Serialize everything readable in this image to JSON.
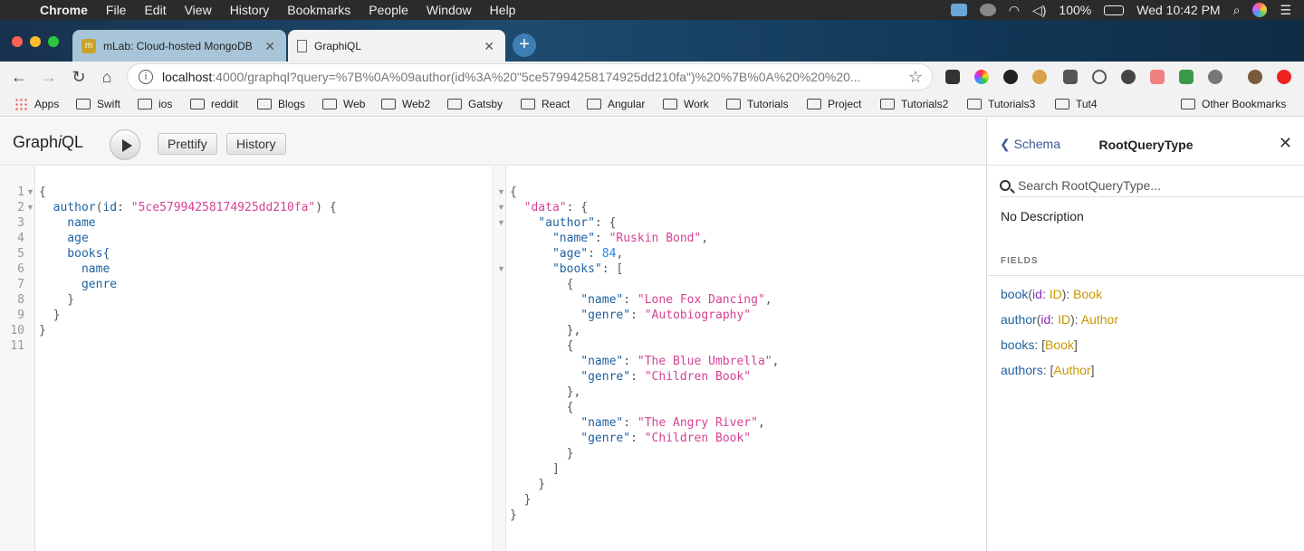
{
  "menubar": {
    "app_name": "Chrome",
    "items": [
      "File",
      "Edit",
      "View",
      "History",
      "Bookmarks",
      "People",
      "Window",
      "Help"
    ],
    "battery": "100%",
    "clock": "Wed 10:42 PM"
  },
  "tabs": [
    {
      "title": "mLab: Cloud-hosted MongoDB",
      "active": false
    },
    {
      "title": "GraphiQL",
      "active": true
    }
  ],
  "omnibox": {
    "host": "localhost",
    "path": ":4000/graphql?query=%7B%0A%09author(id%3A%20\"5ce57994258174925dd210fa\")%20%7B%0A%20%20%20..."
  },
  "bookmarks": {
    "apps_label": "Apps",
    "folders": [
      "Swift",
      "ios",
      "reddit",
      "Blogs",
      "Web",
      "Web2",
      "Gatsby",
      "React",
      "Angular",
      "Work",
      "Tutorials",
      "Project",
      "Tutorials2",
      "Tutorials3",
      "Tut4"
    ],
    "other": "Other Bookmarks"
  },
  "graphiql": {
    "title_pre": "Graph",
    "title_i": "i",
    "title_post": "QL",
    "prettify_label": "Prettify",
    "history_label": "History"
  },
  "query_lines": [
    "{",
    "  author(id: \"5ce57994258174925dd210fa\") {",
    "    name",
    "    age",
    "    books{",
    "      name",
    "      genre",
    "    }",
    "  }",
    "}",
    ""
  ],
  "result": {
    "author_name": "Ruskin Bond",
    "age": "84",
    "books": [
      {
        "name": "Lone Fox Dancing",
        "genre": "Autobiography"
      },
      {
        "name": "The Blue Umbrella",
        "genre": "Children Book"
      },
      {
        "name": "The Angry River",
        "genre": "Children Book"
      }
    ]
  },
  "docs": {
    "back_label": "Schema",
    "title": "RootQueryType",
    "search_placeholder": "Search RootQueryType...",
    "description": "No Description",
    "fields_heading": "FIELDS",
    "fields": [
      {
        "name": "book",
        "arg": "id",
        "arg_type": "ID",
        "type": "Book",
        "list": false
      },
      {
        "name": "author",
        "arg": "id",
        "arg_type": "ID",
        "type": "Author",
        "list": false
      },
      {
        "name": "books",
        "arg": "",
        "arg_type": "",
        "type": "Book",
        "list": true
      },
      {
        "name": "authors",
        "arg": "",
        "arg_type": "",
        "type": "Author",
        "list": true
      }
    ]
  },
  "colors": {
    "keyword": "#1f61a0",
    "string": "#d64292",
    "number": "#2882f9",
    "type": "#ca9800",
    "arg": "#8b2bb9"
  }
}
